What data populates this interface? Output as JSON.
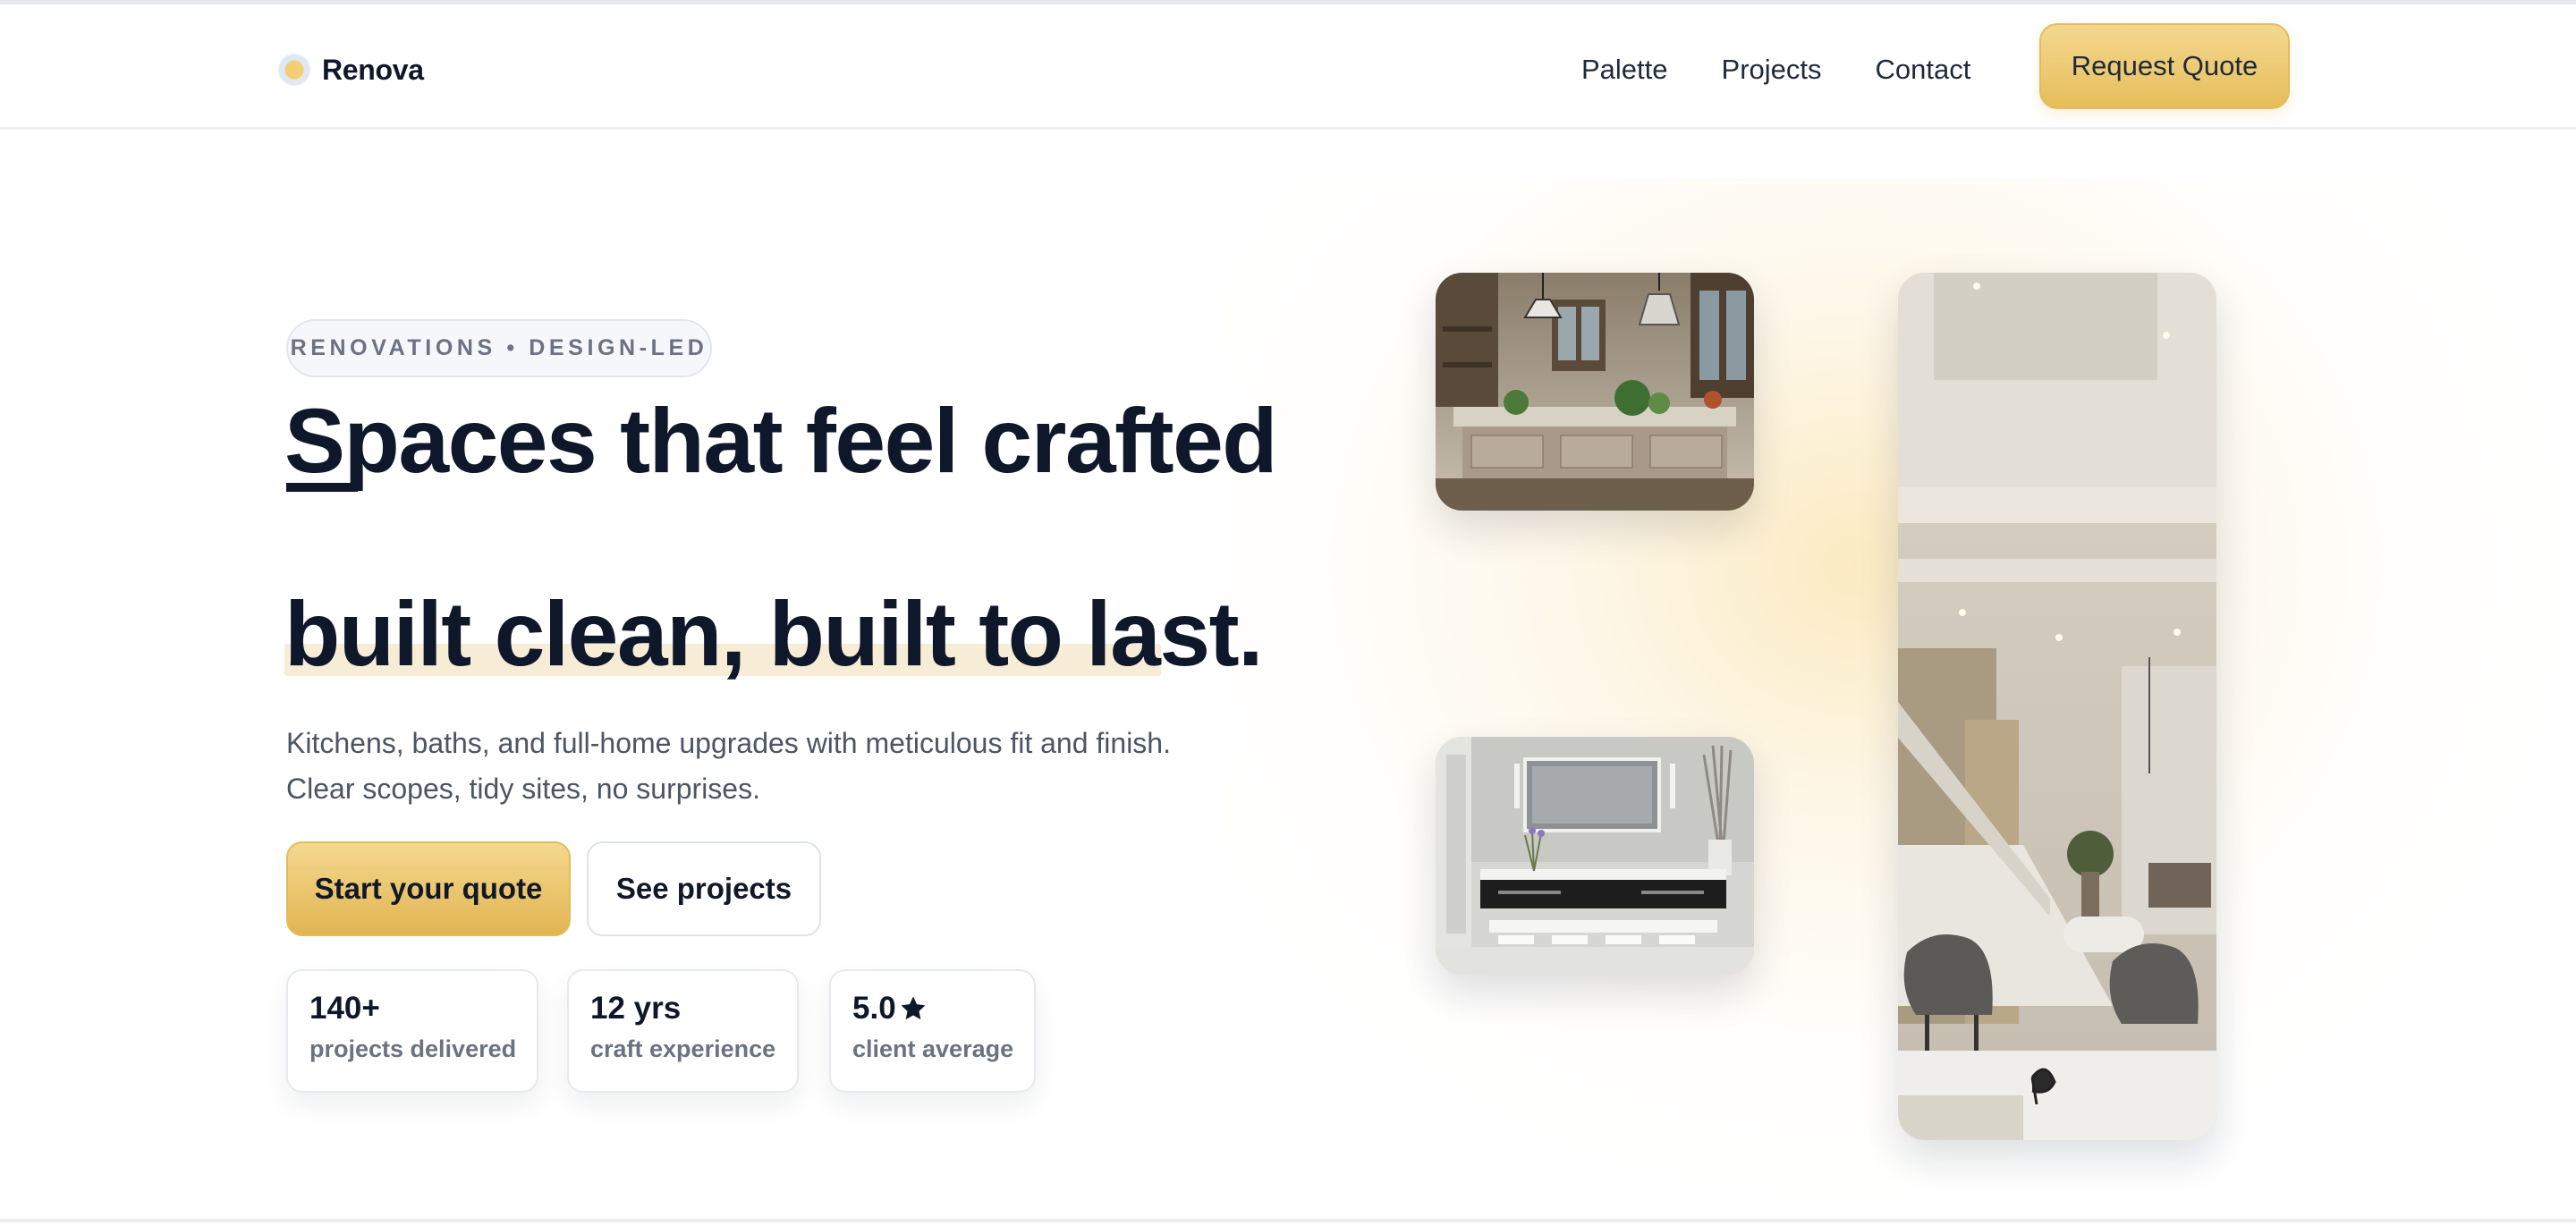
{
  "brand": {
    "name": "Renova",
    "logo_icon": "sun-dot-icon"
  },
  "nav": {
    "links": [
      "Palette",
      "Projects",
      "Contact"
    ],
    "cta": "Request Quote"
  },
  "hero": {
    "eyebrow": "RENOVATIONS • DESIGN-LED",
    "headline_line1": "Spaces that feel crafted",
    "headline_line3": "built clean, built to last.",
    "subtext": "Kitchens, baths, and full-home upgrades with meticulous fit and finish. Clear scopes, tidy sites, no surprises.",
    "primary_button": "Start your quote",
    "secondary_button": "See projects",
    "stats": [
      {
        "value": "140+",
        "label": "projects delivered"
      },
      {
        "value": "12 yrs",
        "label": "craft experience"
      },
      {
        "value": "5.0",
        "label": "client average",
        "icon": "star-icon"
      }
    ]
  },
  "gallery": {
    "images": [
      {
        "name": "kitchen-photo",
        "subject": "rustic kitchen with island"
      },
      {
        "name": "bathroom-photo",
        "subject": "modern bathroom vanity"
      },
      {
        "name": "interior-photo",
        "subject": "living room with staircase"
      }
    ]
  },
  "colors": {
    "accent": "#e7bd5b",
    "accent_light": "#f3d88f",
    "text": "#0f172a",
    "muted": "#6b7280",
    "highlight": "#f7ecd6"
  }
}
